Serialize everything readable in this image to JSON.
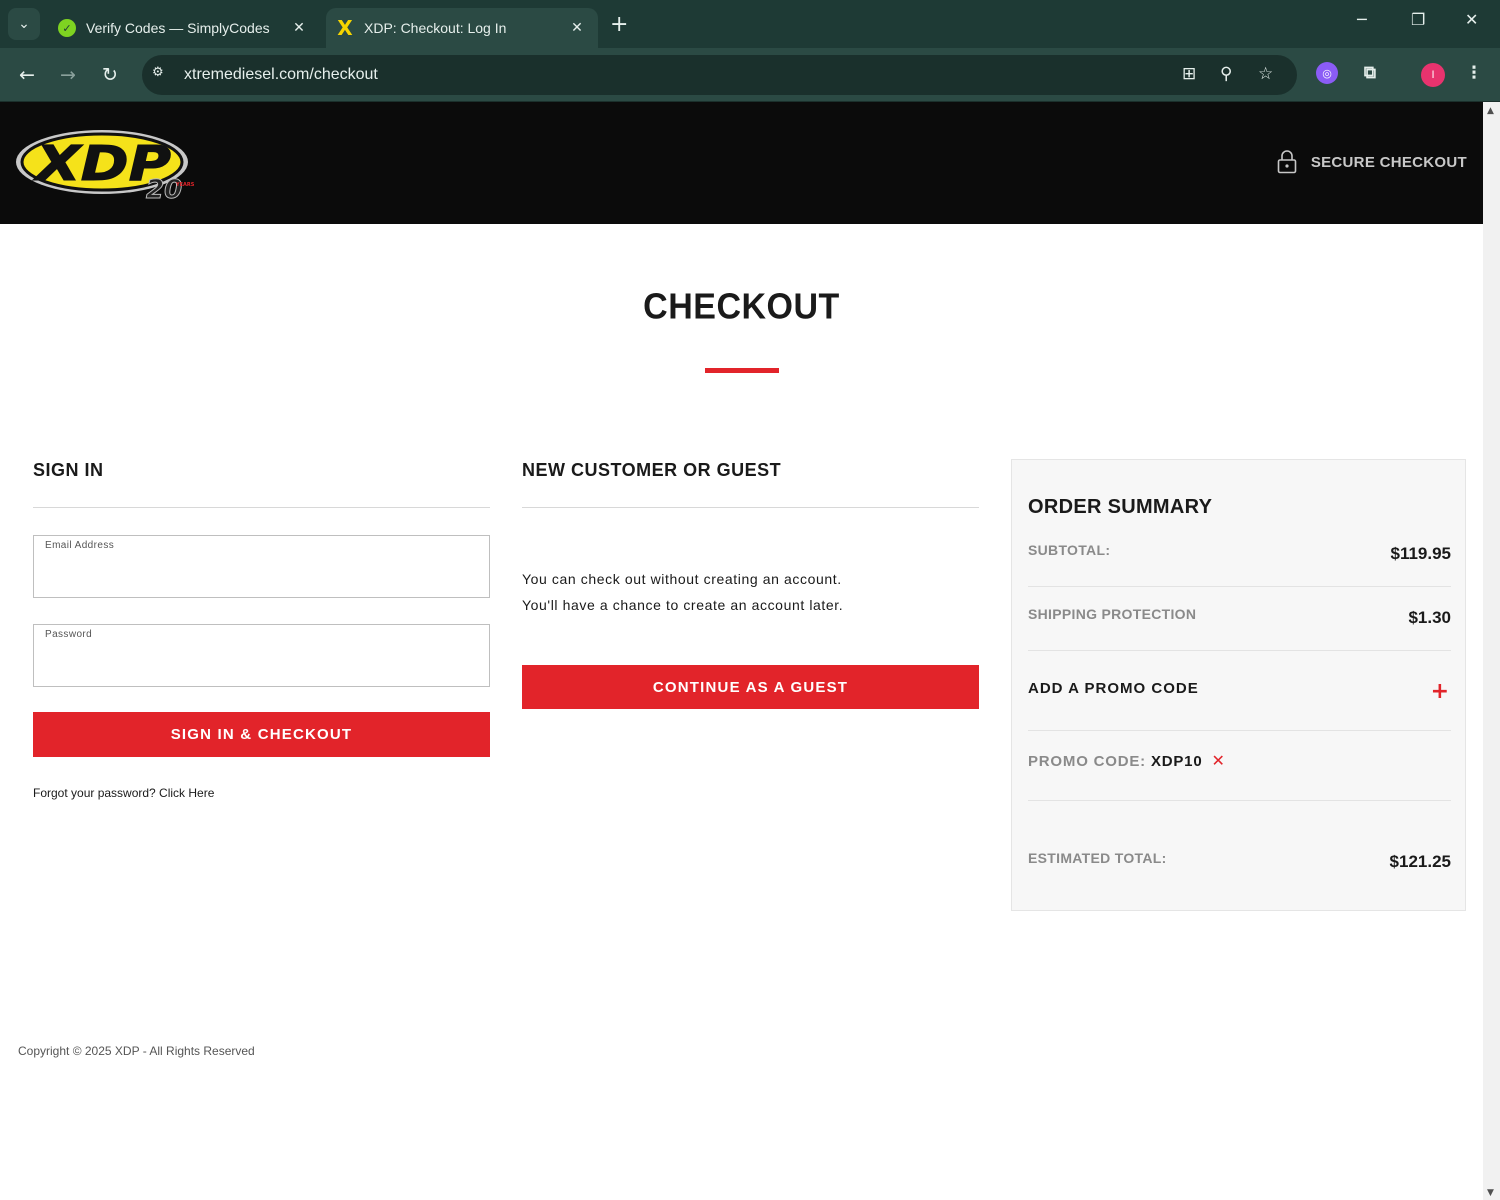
{
  "browser": {
    "tabs": [
      {
        "title": "Verify Codes — SimplyCodes",
        "favicon": "simplycodes-icon",
        "active": false
      },
      {
        "title": "XDP: Checkout: Log In",
        "favicon": "xdp-icon",
        "active": true
      }
    ],
    "url": "xtremediesel.com/checkout",
    "profile_initial": "I"
  },
  "header": {
    "logo_text": "XDP",
    "logo_badge": "20",
    "logo_badge_sub": "YEARS",
    "secure_checkout": "SECURE CHECKOUT"
  },
  "page": {
    "title": "CHECKOUT"
  },
  "sign_in": {
    "heading": "SIGN IN",
    "email_label": "Email Address",
    "email_value": "",
    "password_label": "Password",
    "password_value": "",
    "button": "SIGN IN & CHECKOUT",
    "forgot": "Forgot your password? Click Here"
  },
  "guest": {
    "heading": "NEW CUSTOMER OR GUEST",
    "line1": "You can check out without creating an account.",
    "line2": "You'll have a chance to create an account later.",
    "button": "CONTINUE AS A GUEST"
  },
  "summary": {
    "title": "ORDER SUMMARY",
    "subtotal_label": "SUBTOTAL:",
    "subtotal_value": "$119.95",
    "shipping_label": "SHIPPING PROTECTION",
    "shipping_value": "$1.30",
    "promo_add": "ADD A PROMO CODE",
    "promo_label": "PROMO CODE:",
    "promo_value": "XDP10",
    "total_label": "ESTIMATED TOTAL:",
    "total_value": "$121.25"
  },
  "footer": {
    "copyright": "Copyright © 2025 XDP - All Rights Reserved"
  },
  "colors": {
    "accent_red": "#e2242a",
    "header_bg": "#0b0b0b",
    "browser_frame": "#1e3a35",
    "logo_yellow": "#f5e21a"
  }
}
